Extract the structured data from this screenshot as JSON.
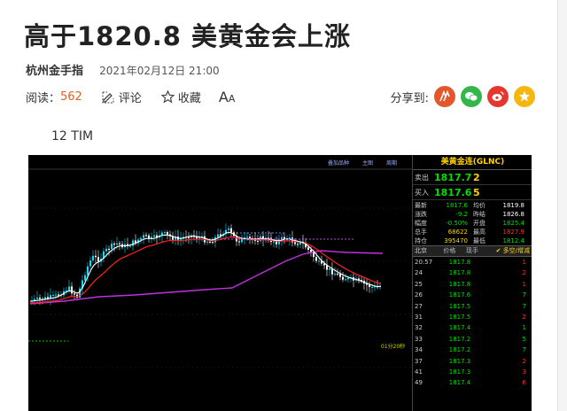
{
  "article": {
    "title": "高于1820.8 美黄金会上涨",
    "author": "杭州金手指",
    "date": "2021年02月12日 21:00",
    "reads_label": "阅读：",
    "reads_count": "562",
    "comment_label": "评论",
    "favorite_label": "收藏",
    "font_size_label": "A",
    "font_size_label_small": "A",
    "share_label": "分享到:",
    "share_targets": [
      "share-a-icon",
      "wechat-icon",
      "weibo-icon",
      "favorite-star-icon"
    ],
    "caption": "12 TIM"
  },
  "colors": {
    "reads_count": "#e06020",
    "share_red": "#e2572c",
    "share_green": "#35b64a",
    "share_weibo": "#e6372f",
    "share_star": "#f5b60f",
    "chart_bg": "#000000",
    "ema_fast": "#ffffff",
    "ema_slow": "#ff2020",
    "ema_long": "#c030e0"
  },
  "quote_panel": {
    "title": "美黄金连(GLNC)",
    "sell": {
      "label": "卖出",
      "price": "1817.7",
      "lots": "2"
    },
    "buy": {
      "label": "买入",
      "price": "1817.6",
      "lots": "5"
    },
    "stats": [
      {
        "l1": "最新",
        "v1": "1817.6",
        "l2": "均价",
        "v2": "1819.8"
      },
      {
        "l1": "涨跌",
        "v1": "-9.2",
        "l2": "昨结",
        "v2": "1826.8"
      },
      {
        "l1": "幅度",
        "v1": "-0.50%",
        "l2": "开盘",
        "v2": "1825.4"
      },
      {
        "l1": "总手",
        "v1": "68622",
        "l2": "最高",
        "v2": "1827.9"
      },
      {
        "l1": "持仓",
        "v1": "395470",
        "l2": "最低",
        "v2": "1812.4"
      }
    ],
    "tick_header": {
      "time": "北京",
      "price": "价格",
      "vol": "现手",
      "flag": "✔ 多空/增减"
    },
    "ticks": [
      {
        "time": "20:57",
        "price": "1817.8",
        "vol": "1"
      },
      {
        "time": "24",
        "price": "1817.8",
        "vol": "2"
      },
      {
        "time": "25",
        "price": "1817.8",
        "vol": "1"
      },
      {
        "time": "26",
        "price": "1817.6",
        "vol": "7"
      },
      {
        "time": "27",
        "price": "1817.5",
        "vol": "7"
      },
      {
        "time": "31",
        "price": "1817.5",
        "vol": "2"
      },
      {
        "time": "32",
        "price": "1817.4",
        "vol": "1"
      },
      {
        "time": "33",
        "price": "1817.2",
        "vol": "5"
      },
      {
        "time": "34",
        "price": "1817.2",
        "vol": "7"
      },
      {
        "time": "37",
        "price": "1817.3",
        "vol": "2"
      },
      {
        "time": "41",
        "price": "1817.3",
        "vol": "3"
      },
      {
        "time": "49",
        "price": "1817.4",
        "vol": "6"
      }
    ]
  },
  "chart_header": {
    "left": "叠加品种",
    "mid": "主图",
    "right": "周期"
  },
  "chart_countdown": "01分20秒"
}
